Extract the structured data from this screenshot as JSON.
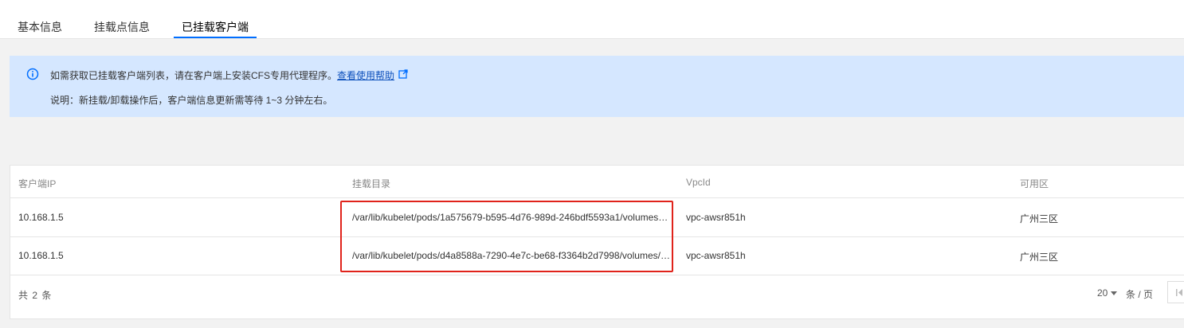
{
  "header": {
    "title_fragment": "\\.. . . . ."
  },
  "tabs": [
    {
      "label": "基本信息",
      "active": false
    },
    {
      "label": "挂载点信息",
      "active": false
    },
    {
      "label": "已挂载客户端",
      "active": true
    }
  ],
  "notice": {
    "line1_text": "如需获取已挂载客户端列表，请在客户端上安装CFS专用代理程序。",
    "help_link": "查看使用帮助",
    "line2_text": "说明：新挂载/卸载操作后，客户端信息更新需等待 1~3 分钟左右。",
    "icons": {
      "info": "info-icon",
      "external": "external-link-icon"
    }
  },
  "table": {
    "columns": [
      "客户端IP",
      "挂载目录",
      "VpcId",
      "可用区"
    ],
    "rows": [
      {
        "ip": "10.168.1.5",
        "dir": "/var/lib/kubelet/pods/1a575679-b595-4d76-989d-246bdf5593a1/volumes…",
        "vpc": "vpc-awsr851h",
        "zone": "广州三区"
      },
      {
        "ip": "10.168.1.5",
        "dir": "/var/lib/kubelet/pods/d4a8588a-7290-4e7c-be68-f3364b2d7998/volumes/…",
        "vpc": "vpc-awsr851h",
        "zone": "广州三区"
      }
    ]
  },
  "pagination": {
    "total_text": "共 2 条",
    "page_size": "20",
    "per_page_label": "条 / 页"
  },
  "colors": {
    "accent": "#006eff",
    "notice_bg": "#d5e7ff",
    "highlight": "#e0231b"
  }
}
